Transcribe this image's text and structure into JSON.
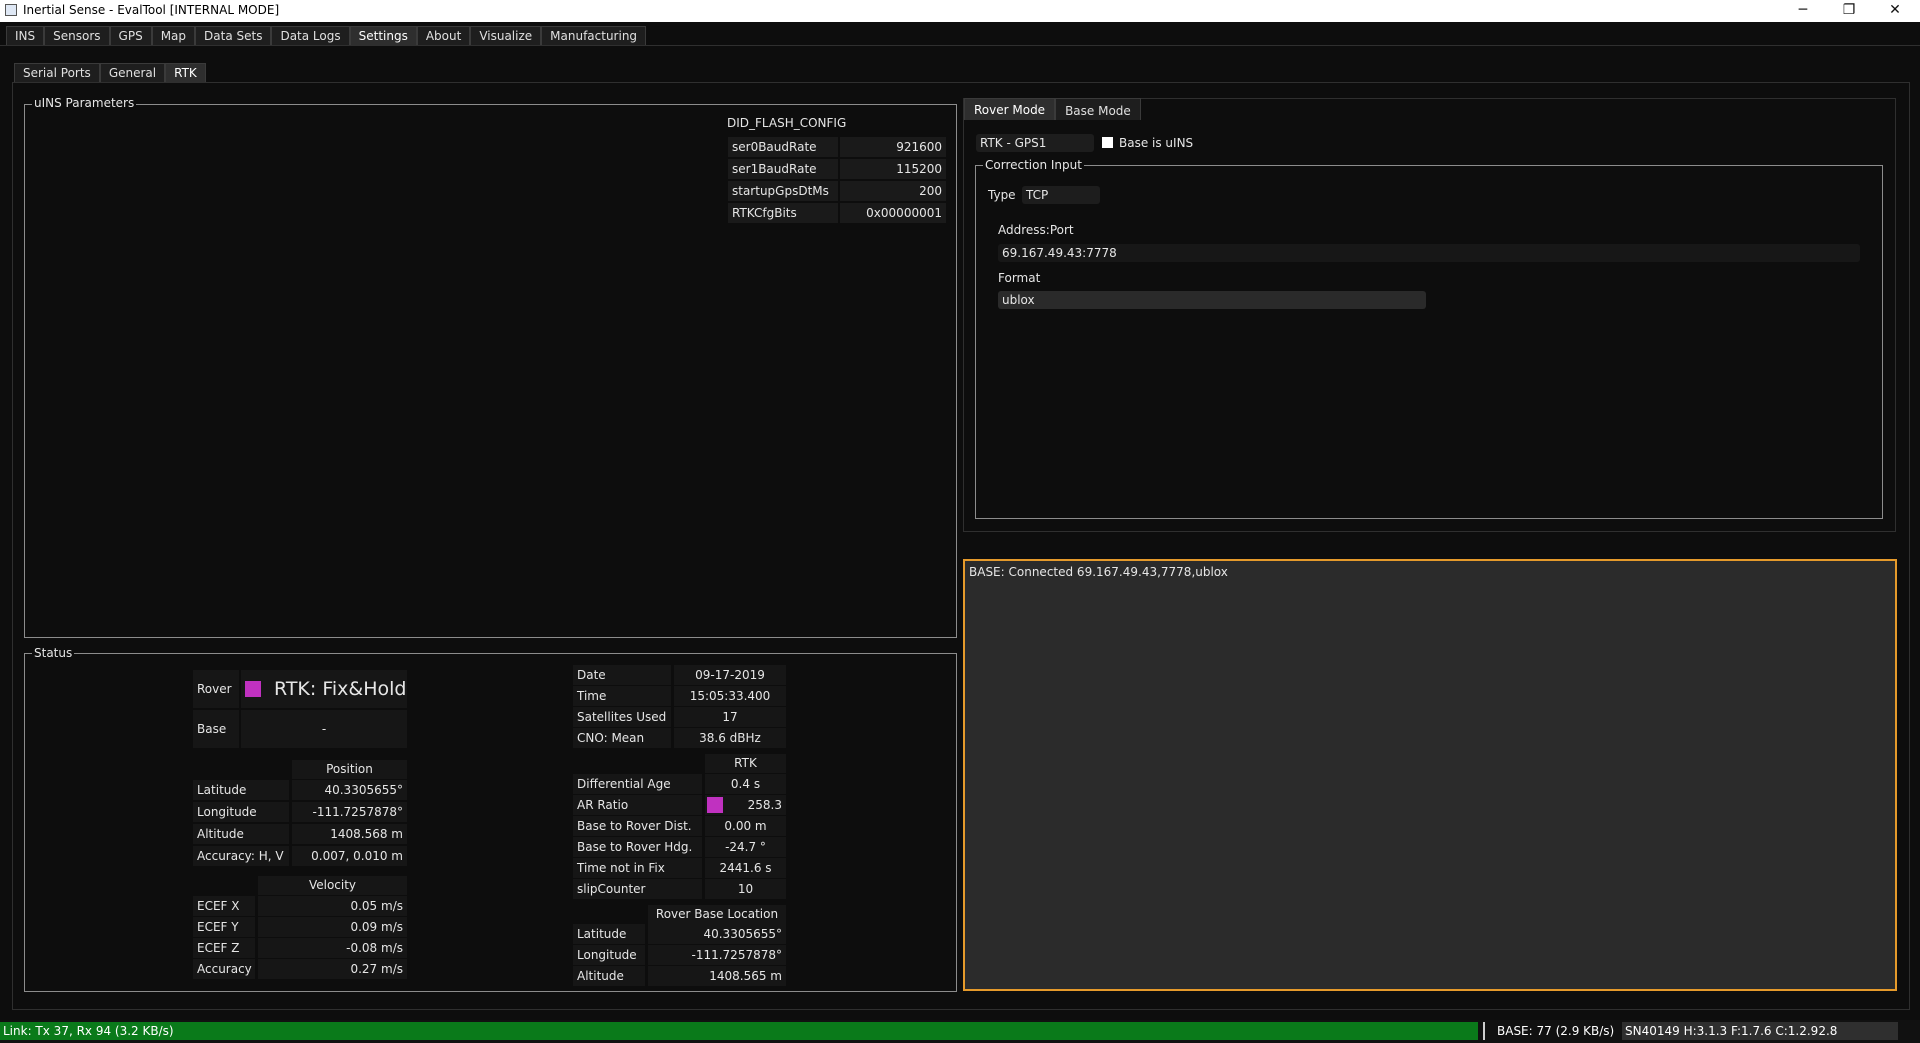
{
  "window": {
    "title": "Inertial Sense - EvalTool [INTERNAL MODE]",
    "minimize": "─",
    "maximize": "❐",
    "close": "✕"
  },
  "main_tabs": [
    "INS",
    "Sensors",
    "GPS",
    "Map",
    "Data Sets",
    "Data Logs",
    "Settings",
    "About",
    "Visualize",
    "Manufacturing"
  ],
  "sub_tabs": [
    "Serial Ports",
    "General",
    "RTK"
  ],
  "uins": {
    "group_title": "uINS Parameters",
    "config_title": "DID_FLASH_CONFIG",
    "rows": [
      {
        "key": "ser0BaudRate",
        "value": "921600"
      },
      {
        "key": "ser1BaudRate",
        "value": "115200"
      },
      {
        "key": "startupGpsDtMs",
        "value": "200"
      },
      {
        "key": "RTKCfgBits",
        "value": "0x00000001"
      }
    ]
  },
  "mode_tabs": [
    "Rover Mode",
    "Base Mode"
  ],
  "rover": {
    "rtk_select": "RTK - GPS1",
    "base_is_uins_label": "Base is uINS",
    "correction_title": "Correction Input",
    "type_label": "Type",
    "type_value": "TCP",
    "address_label": "Address:Port",
    "address_value": "69.167.49.43:7778",
    "format_label": "Format",
    "format_value": "ublox"
  },
  "log": {
    "text": "BASE: Connected 69.167.49.43,7778,ublox",
    "border_color": "#e59a2b"
  },
  "status": {
    "group_title": "Status",
    "rover_label": "Rover",
    "rover_value": "RTK: Fix&Hold",
    "base_label": "Base",
    "base_value": "-",
    "indicator_color": "#c031c0",
    "position": {
      "header": "Position",
      "rows": [
        {
          "key": "Latitude",
          "value": "40.3305655°"
        },
        {
          "key": "Longitude",
          "value": "-111.7257878°"
        },
        {
          "key": "Altitude",
          "value": "1408.568 m"
        },
        {
          "key": "Accuracy: H, V",
          "value": "0.007, 0.010 m"
        }
      ]
    },
    "velocity": {
      "header": "Velocity",
      "rows": [
        {
          "key": "ECEF X",
          "value": "0.05 m/s"
        },
        {
          "key": "ECEF Y",
          "value": "0.09 m/s"
        },
        {
          "key": "ECEF Z",
          "value": "-0.08 m/s"
        },
        {
          "key": "Accuracy",
          "value": "0.27 m/s"
        }
      ]
    },
    "info": {
      "rows": [
        {
          "key": "Date",
          "value": "09-17-2019"
        },
        {
          "key": "Time",
          "value": "15:05:33.400"
        },
        {
          "key": "Satellites Used",
          "value": "17"
        },
        {
          "key": "CNO: Mean",
          "value": "38.6 dBHz"
        }
      ]
    },
    "rtk": {
      "header": "RTK",
      "rows": [
        {
          "key": "Differential Age",
          "value": "0.4 s"
        },
        {
          "key": "AR Ratio",
          "value": "258.3"
        },
        {
          "key": "Base to Rover Dist.",
          "value": "0.00 m"
        },
        {
          "key": "Base to Rover Hdg.",
          "value": "-24.7 °"
        },
        {
          "key": "Time not in Fix",
          "value": "2441.6 s"
        },
        {
          "key": "slipCounter",
          "value": "10"
        }
      ]
    },
    "base_location": {
      "header": "Rover Base Location",
      "rows": [
        {
          "key": "Latitude",
          "value": "40.3305655°"
        },
        {
          "key": "Longitude",
          "value": "-111.7257878°"
        },
        {
          "key": "Altitude",
          "value": "1408.565 m"
        }
      ]
    }
  },
  "statusbar": {
    "link": "Link: Tx 37, Rx 94  (3.2 KB/s)",
    "base": "BASE: 77  (2.9 KB/s)",
    "serial": "SN40149 H:3.1.3  F:1.7.6  C:1.2.92.8",
    "link_color": "#0a7a1a"
  }
}
